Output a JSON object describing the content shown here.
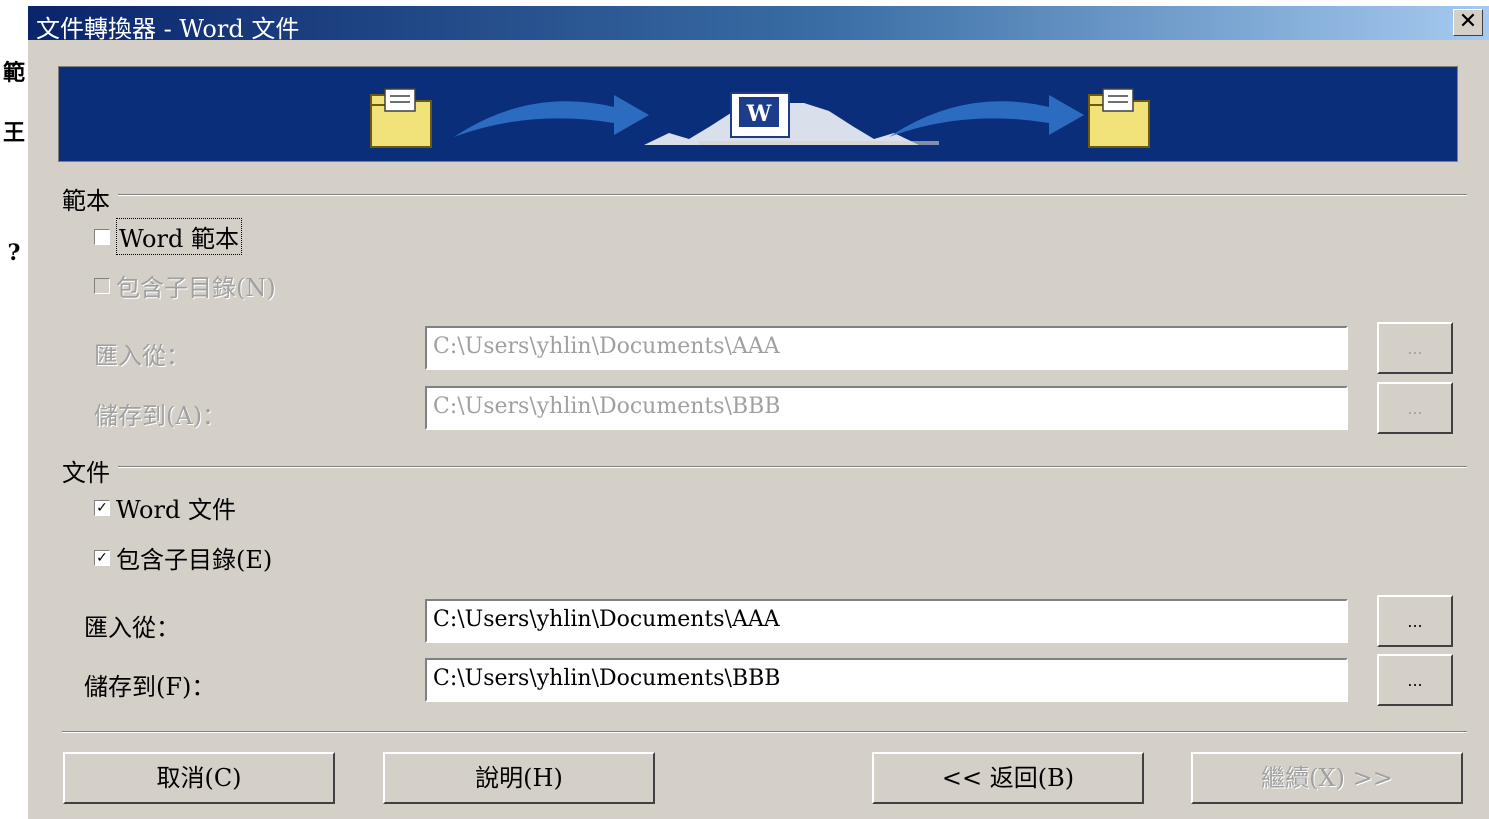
{
  "side_chars": [
    "範",
    "王",
    "?"
  ],
  "window": {
    "title": "文件轉換器 - Word 文件",
    "close_label": "✕"
  },
  "templates": {
    "group_label": "範本",
    "word_templates_label": "Word 範本",
    "word_templates_checked": false,
    "include_subdirs_label": "包含子目錄(N)",
    "include_subdirs_checked": false,
    "import_from_label": "匯入從：",
    "import_from_value": "C:\\Users\\yhlin\\Documents\\AAA",
    "save_to_label": "儲存到(A)：",
    "save_to_value": "C:\\Users\\yhlin\\Documents\\BBB",
    "browse_label": "..."
  },
  "documents": {
    "group_label": "文件",
    "word_documents_label": "Word 文件",
    "word_documents_checked": true,
    "include_subdirs_label": "包含子目錄(E)",
    "include_subdirs_checked": true,
    "import_from_label": "匯入從：",
    "import_from_value": "C:\\Users\\yhlin\\Documents\\AAA",
    "save_to_label": "儲存到(F)：",
    "save_to_value": "C:\\Users\\yhlin\\Documents\\BBB",
    "browse_label": "..."
  },
  "buttons": {
    "cancel": "取消(C)",
    "help": "說明(H)",
    "back": "<< 返回(B)",
    "next": "繼續(X) >>"
  },
  "colors": {
    "dialog_bg": "#d4d0c8",
    "title_start": "#0a246a",
    "title_end": "#a6caf0",
    "banner_bg": "#0a2e7a",
    "disabled_text": "#a0a0a0"
  },
  "icons": {
    "banner_left": "folder-icon",
    "banner_center": "word-document-icon",
    "banner_right": "folder-icon",
    "arrows": "arrow-right-icon"
  }
}
